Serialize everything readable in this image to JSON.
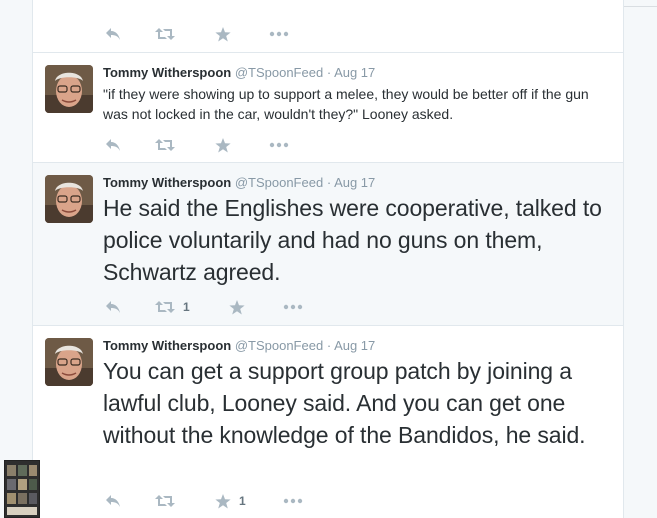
{
  "tweets": [
    {
      "fullname": "Tommy Witherspoon",
      "username": "@TSpoonFeed",
      "separator": "·",
      "time": "Aug 17",
      "text": "\"if they were showing up to support a melee, they would be better off if the gun was not locked in the car, wouldn't they?\" Looney asked.",
      "retweet_count": "",
      "favorite_count": ""
    },
    {
      "fullname": "Tommy Witherspoon",
      "username": "@TSpoonFeed",
      "separator": "·",
      "time": "Aug 17",
      "text": "He said the Englishes were cooperative, talked to police voluntarily and had no guns on them, Schwartz agreed.",
      "retweet_count": "1",
      "favorite_count": ""
    },
    {
      "fullname": "Tommy Witherspoon",
      "username": "@TSpoonFeed",
      "separator": "·",
      "time": "Aug 17",
      "text": "You can get a support group patch by joining a lawful club, Looney said. And you can get one without the knowledge of the Bandidos, he said.",
      "retweet_count": "",
      "favorite_count": "1"
    }
  ],
  "colors": {
    "page_bg": "#f5f8fa",
    "card_bg": "#ffffff",
    "hover_bg": "#f5f8fa",
    "text": "#292f33",
    "muted": "#8899a6",
    "action_icon": "#aab8c2"
  },
  "icons": [
    "reply-icon",
    "retweet-icon",
    "favorite-star-icon",
    "more-dots-icon"
  ]
}
